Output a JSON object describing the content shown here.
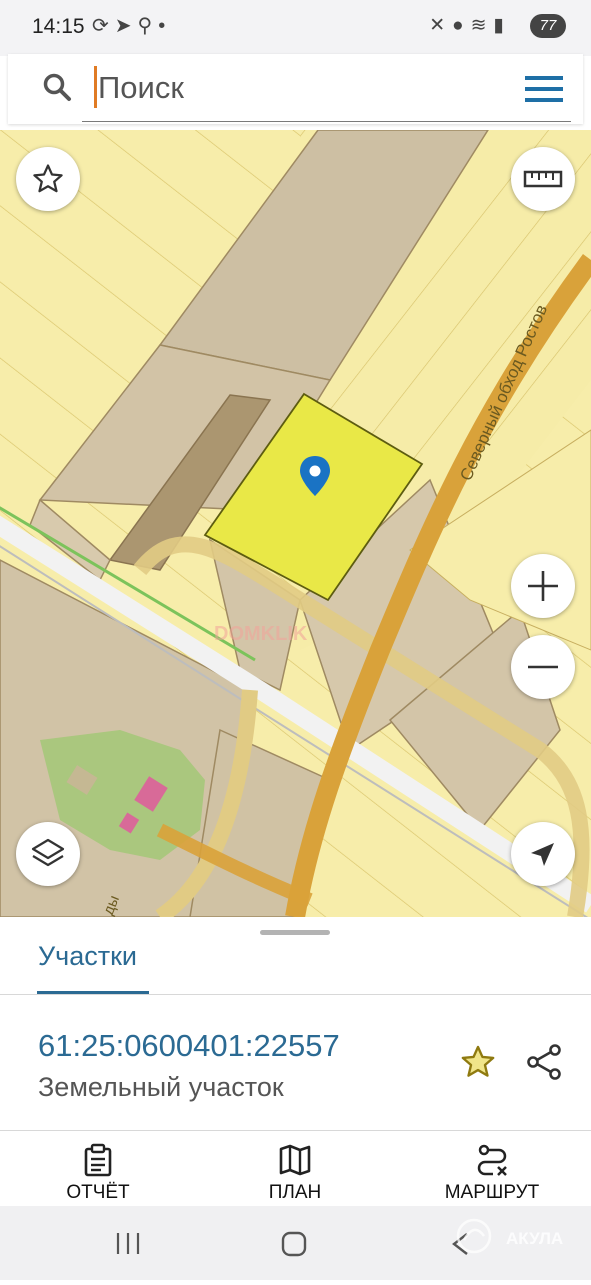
{
  "status_bar": {
    "time": "14:15",
    "left_icons": [
      "sync-icon",
      "telegram-icon",
      "search-icon",
      "dot-icon"
    ],
    "right_icons": [
      "mute-icon",
      "location-icon",
      "wifi-icon",
      "signal-icon"
    ],
    "battery": "77"
  },
  "search": {
    "placeholder": "Поиск",
    "value": ""
  },
  "map": {
    "road_label": "Северный обход Ростов",
    "road_label_2": "ды",
    "watermark": "DOMKLIK",
    "colors": {
      "parcel_fill": "#f7ecaa",
      "selected_parcel": "#e8e84a",
      "road": "#d8a73e",
      "marker": "#1a73c4",
      "green_area": "#a7c57a"
    }
  },
  "panel": {
    "tab_label": "Участки",
    "cadastral_number": "61:25:0600401:22557",
    "property_type": "Земельный участок"
  },
  "actions": [
    {
      "label": "ОТЧЁТ",
      "icon": "report-icon"
    },
    {
      "label": "ПЛАН",
      "icon": "map-plan-icon"
    },
    {
      "label": "МАРШРУТ",
      "icon": "route-icon"
    }
  ],
  "nav": {
    "watermark": "АКУЛА"
  }
}
